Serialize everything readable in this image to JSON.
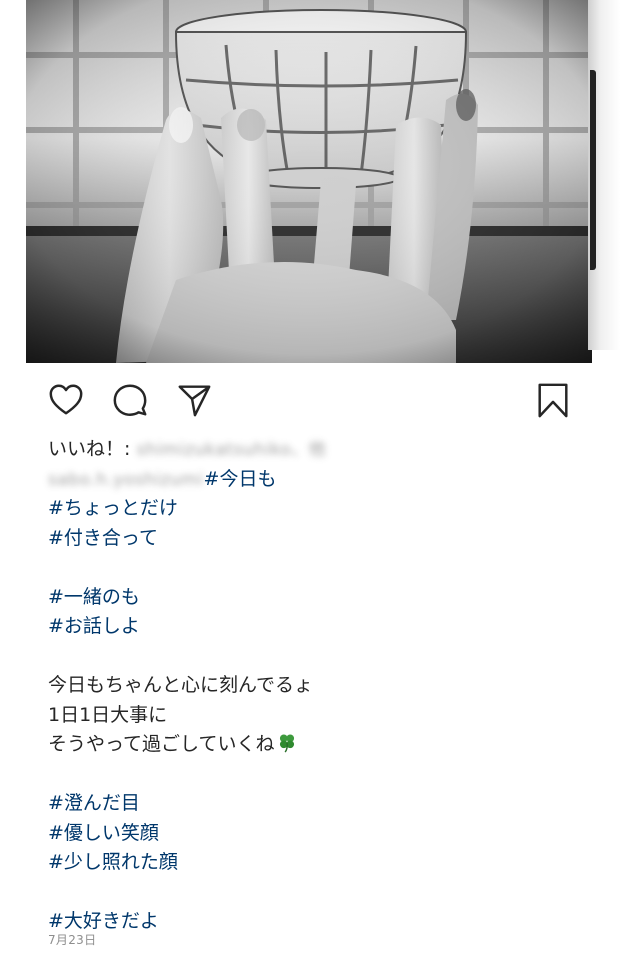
{
  "post": {
    "likes_prefix": "いいね！:",
    "likes_users_blurred": "shimizukatsuhiko、他",
    "author_blurred": "sabo.h.yoshizumi",
    "caption": {
      "l1_tag": "#今日も",
      "l2_tag": "#ちょっとだけ",
      "l3_tag": "#付き合って",
      "l4_tag": "#一緒のも",
      "l5_tag": "#お話しよ",
      "l6_text": "今日もちゃんと心に刻んでるょ",
      "l7_text": "1日1日大事に",
      "l8_text": "そうやって過ごしていくね",
      "l9_tag": "#澄んだ目",
      "l10_tag": "#優しい笑顔",
      "l11_tag": "#少し照れた顔",
      "l12_tag": "#大好きだよ"
    },
    "date": "7月23日"
  },
  "icons": {
    "like": "heart-icon",
    "comment": "comment-icon",
    "share": "paper-plane-icon",
    "save": "bookmark-icon",
    "emoji": "four-leaf-clover-icon"
  },
  "colors": {
    "text": "#262626",
    "hashtag": "#00376b",
    "date": "#8e8e8e"
  }
}
